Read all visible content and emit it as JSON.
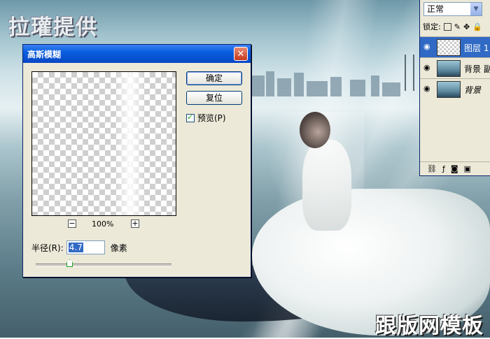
{
  "watermarks": {
    "top": "拉瓘提供",
    "bottom": "跟版网模板"
  },
  "dialog": {
    "title": "高斯模糊",
    "close_glyph": "✕",
    "ok_label": "确定",
    "reset_label": "复位",
    "preview_label": "预览(P)",
    "preview_checked": true,
    "zoom_out_glyph": "−",
    "zoom_in_glyph": "+",
    "zoom_level": "100%",
    "radius_label": "半径(R):",
    "radius_value": "4.7",
    "radius_unit": "像素"
  },
  "layers_panel": {
    "blend_mode": "正常",
    "lock_label": "锁定:",
    "layers": [
      {
        "name": "图层 1",
        "visible": true,
        "selected": true
      },
      {
        "name": "背景 副",
        "visible": true,
        "selected": false
      },
      {
        "name": "背景",
        "visible": true,
        "selected": false
      }
    ]
  },
  "colors": {
    "dialog_bg": "#ece9d8",
    "titlebar": "#0a5ee0",
    "selection": "#316ac5"
  }
}
